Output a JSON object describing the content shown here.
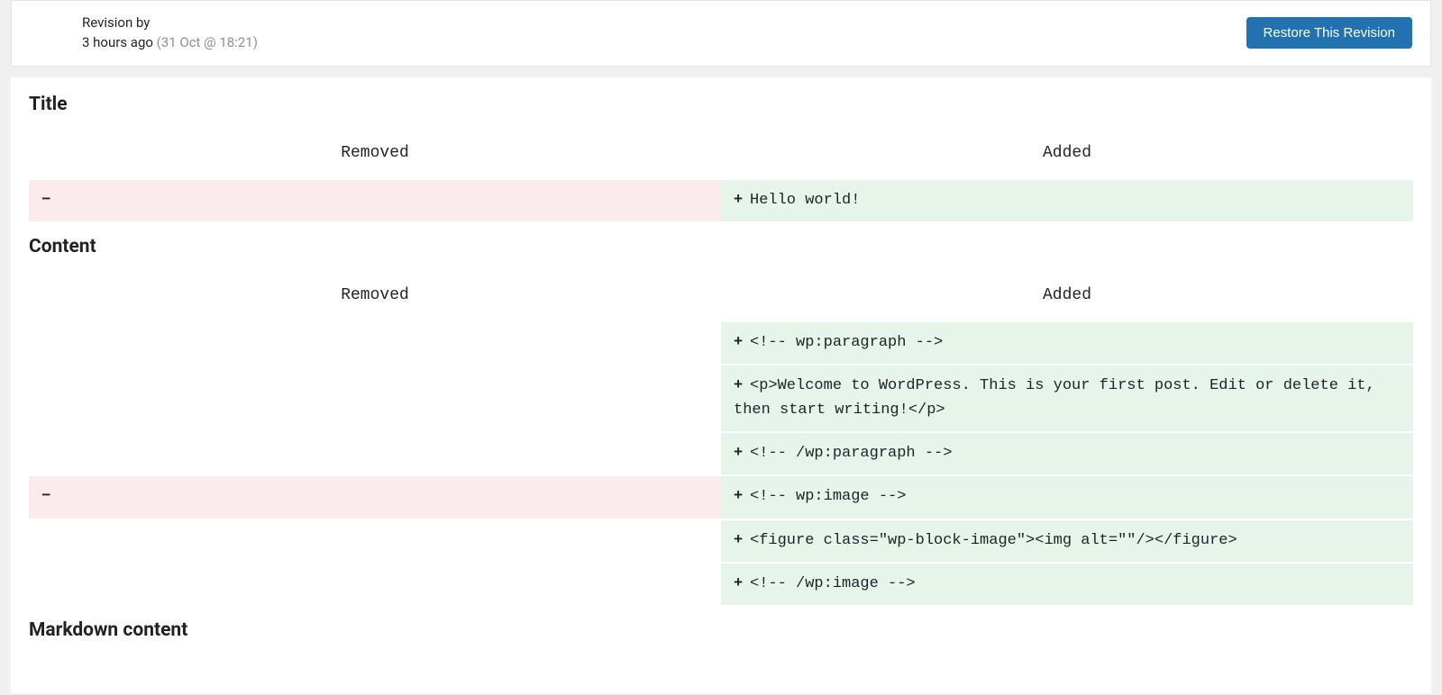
{
  "header": {
    "revision_by_label": "Revision by",
    "time_ago": "3 hours ago",
    "timestamp": "(31 Oct @ 18:21)",
    "restore_button": "Restore This Revision"
  },
  "diff_common": {
    "removed_header": "Removed",
    "added_header": "Added",
    "minus": "−",
    "plus": "+"
  },
  "sections": {
    "title": {
      "heading": "Title",
      "rows": [
        {
          "removed": "",
          "added": "Hello world!"
        }
      ]
    },
    "content": {
      "heading": "Content",
      "rows": [
        {
          "removed": null,
          "added": "<!-- wp:paragraph -->"
        },
        {
          "removed": null,
          "added": "<p>Welcome to WordPress. This is your first post. Edit or delete it, then start writing!</p>"
        },
        {
          "removed": null,
          "added": "<!-- /wp:paragraph -->"
        },
        {
          "removed": "",
          "added": "<!-- wp:image -->"
        },
        {
          "removed": null,
          "added": "<figure class=\"wp-block-image\"><img alt=\"\"/></figure>"
        },
        {
          "removed": null,
          "added": "<!-- /wp:image -->"
        }
      ]
    },
    "markdown": {
      "heading": "Markdown content"
    }
  }
}
